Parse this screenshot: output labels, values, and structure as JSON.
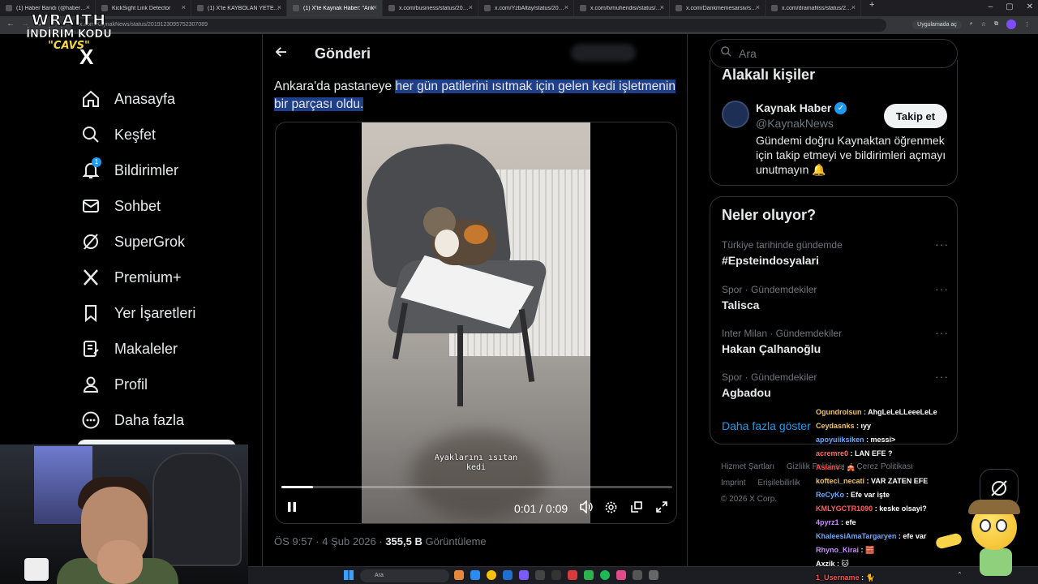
{
  "browser": {
    "tabs": [
      {
        "label": "(1) Haber Bandı (@haberbandi)",
        "active": false
      },
      {
        "label": "KickSight Link Detector",
        "active": false
      },
      {
        "label": "(1) X'te KAYBOLAN YETENEK: \"",
        "active": false
      },
      {
        "label": "(1) X'te Kaynak Haber: \"Ank",
        "active": true
      },
      {
        "label": "x.com/business/status/201932",
        "active": false
      },
      {
        "label": "x.com/YzbAltay/status/2019282",
        "active": false
      },
      {
        "label": "x.com/tvmuhendisi/status/201",
        "active": false
      },
      {
        "label": "x.com/Dankmemesarsiv/status/",
        "active": false
      },
      {
        "label": "x.com/dramafilss/status/20193",
        "active": false
      }
    ],
    "url": "x.com/KaynakNews/status/2019123095752307089",
    "app_button": "Uygulamada aç"
  },
  "overlay": {
    "brand": "WRAITH",
    "discount_line": "İNDİRİM KODU",
    "discount_code": "\"CAVS\""
  },
  "nav": {
    "logo": "X",
    "items": [
      {
        "label": "Anasayfa",
        "icon": "home-icon"
      },
      {
        "label": "Keşfet",
        "icon": "search-icon"
      },
      {
        "label": "Bildirimler",
        "icon": "bell-icon",
        "badge": "1"
      },
      {
        "label": "Sohbet",
        "icon": "mail-icon"
      },
      {
        "label": "SuperGrok",
        "icon": "grok-icon"
      },
      {
        "label": "Premium+",
        "icon": "x-premium-icon"
      },
      {
        "label": "Yer İşaretleri",
        "icon": "bookmark-icon"
      },
      {
        "label": "Makaleler",
        "icon": "article-icon"
      },
      {
        "label": "Profil",
        "icon": "profile-icon"
      },
      {
        "label": "Daha fazla",
        "icon": "more-icon"
      }
    ]
  },
  "post": {
    "header_title": "Gönderi",
    "text_plain": "Ankara'da pastaneye ",
    "text_selected": "her gün patilerini ısıtmak için gelen kedi işletmenin bir parçası oldu.",
    "video_caption_line1": "Ayaklarını ısıtan",
    "video_caption_line2": "kedi",
    "video_time": "0:01 / 0:09",
    "progress": 0.08,
    "timestamp": "ÖS 9:57 · 4 Şub 2026 · ",
    "views_count": "355,5 B",
    "views_label": "Görüntüleme"
  },
  "sidebar": {
    "search_placeholder": "Ara",
    "related": {
      "title": "Alakalı kişiler",
      "name": "Kaynak Haber",
      "handle": "@KaynakNews",
      "follow_label": "Takip et",
      "bio": "Gündemi doğru Kaynaktan öğrenmek için takip etmeyi ve bildirimleri açmayı unutmayın 🔔"
    },
    "trends": {
      "title": "Neler oluyor?",
      "items": [
        {
          "category": "Türkiye tarihinde gündemde",
          "name": "#Epsteindosyalari"
        },
        {
          "category": "Spor · Gündemdekiler",
          "name": "Talisca"
        },
        {
          "category": "Inter Milan · Gündemdekiler",
          "name": "Hakan Çalhanoğlu"
        },
        {
          "category": "Spor · Gündemdekiler",
          "name": "Agbadou"
        }
      ],
      "show_more": "Daha fazla göster"
    },
    "footer": {
      "links_row1": [
        "Hizmet Şartları",
        "Gizlilik Politikası",
        "Çerez Politikası"
      ],
      "links_row2": [
        "Imprint",
        "Erişilebilirlik"
      ],
      "copyright": "© 2026 X Corp."
    }
  },
  "chat": [
    {
      "user": "Ogundrolsun",
      "msg": "AhgLeLeLLeeeLeLe",
      "color": "#f0c36a"
    },
    {
      "user": "Ceydasnks",
      "msg": "ıyy",
      "color": "#f0c36a"
    },
    {
      "user": "apoyuiiksiken",
      "msg": "messi>",
      "color": "#6aa9ff"
    },
    {
      "user": "acremre0",
      "msg": "LAN EFE ?",
      "color": "#ff6a6a"
    },
    {
      "user": "Asianv",
      "msg": "🎪",
      "color": "#ff4d4d"
    },
    {
      "user": "kofteci_necati",
      "msg": "VAR ZATEN EFE",
      "color": "#f0c36a"
    },
    {
      "user": "ReCyKo",
      "msg": "Efe var işte",
      "color": "#6aa9ff"
    },
    {
      "user": "KMLYGCTR1090",
      "msg": "keske olsayi?",
      "color": "#ff5f5f"
    },
    {
      "user": "4pyrz1",
      "msg": "efe",
      "color": "#c98aff"
    },
    {
      "user": "KhaleesiAmaTargaryen",
      "msg": "efe var",
      "color": "#6aa9ff"
    },
    {
      "user": "Rhyno_Kirai",
      "msg": "🧱",
      "color": "#c98aff"
    },
    {
      "user": "Axzik",
      "msg": "🐱",
      "color": "#ffffff"
    },
    {
      "user": "1_Username",
      "msg": "🐈",
      "color": "#ff4d4d"
    }
  ],
  "taskbar": {
    "search_placeholder": "Ara"
  }
}
